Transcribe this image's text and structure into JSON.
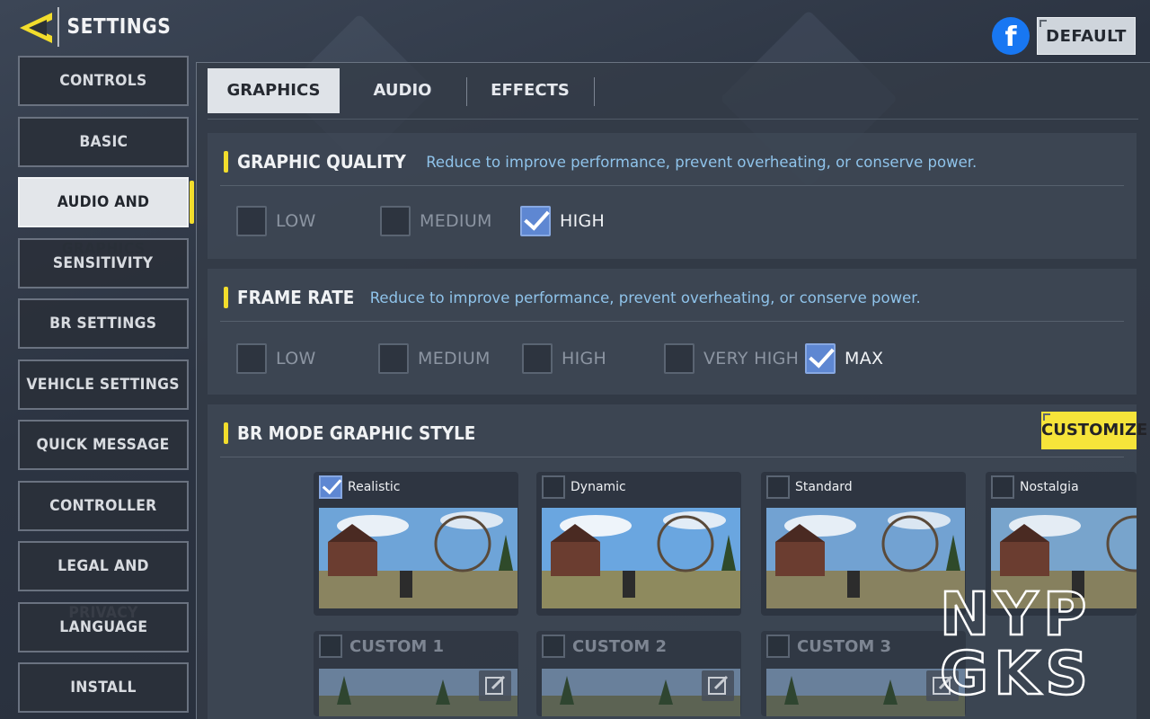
{
  "header": {
    "title": "SETTINGS",
    "default_label": "DEFAULT",
    "facebook_letter": "f"
  },
  "sidebar": {
    "items": [
      {
        "label": "CONTROLS",
        "active": false
      },
      {
        "label": "BASIC",
        "active": false
      },
      {
        "label": "AUDIO AND GRAPHICS",
        "active": true
      },
      {
        "label": "SENSITIVITY",
        "active": false
      },
      {
        "label": "BR SETTINGS",
        "active": false
      },
      {
        "label": "VEHICLE SETTINGS",
        "active": false
      },
      {
        "label": "QUICK MESSAGE",
        "active": false
      },
      {
        "label": "CONTROLLER",
        "active": false
      },
      {
        "label": "LEGAL AND PRIVACY",
        "active": false
      },
      {
        "label": "LANGUAGE",
        "active": false
      },
      {
        "label": "INSTALL",
        "active": false
      }
    ]
  },
  "tabs": [
    {
      "label": "GRAPHICS",
      "active": true
    },
    {
      "label": "AUDIO",
      "active": false
    },
    {
      "label": "EFFECTS",
      "active": false
    }
  ],
  "graphic_quality": {
    "title": "GRAPHIC QUALITY",
    "description": "Reduce to improve performance, prevent overheating, or conserve power.",
    "options": [
      {
        "label": "LOW",
        "checked": false
      },
      {
        "label": "MEDIUM",
        "checked": false
      },
      {
        "label": "HIGH",
        "checked": true
      }
    ]
  },
  "frame_rate": {
    "title": "FRAME RATE",
    "description": "Reduce to improve performance, prevent overheating, or conserve power.",
    "options": [
      {
        "label": "LOW",
        "checked": false
      },
      {
        "label": "MEDIUM",
        "checked": false
      },
      {
        "label": "HIGH",
        "checked": false
      },
      {
        "label": "VERY HIGH",
        "checked": false
      },
      {
        "label": "MAX",
        "checked": true
      }
    ]
  },
  "br_style": {
    "title": "BR MODE GRAPHIC STYLE",
    "customize_label": "CUSTOMIZE",
    "styles": [
      {
        "name": "Realistic",
        "checked": true
      },
      {
        "name": "Dynamic",
        "checked": false
      },
      {
        "name": "Standard",
        "checked": false
      },
      {
        "name": "Nostalgia",
        "checked": false
      }
    ],
    "customs": [
      {
        "name": "CUSTOM 1"
      },
      {
        "name": "CUSTOM 2"
      },
      {
        "name": "CUSTOM 3"
      }
    ]
  },
  "watermark": {
    "line1": "NYP",
    "line2": "GKS"
  },
  "colors": {
    "accent": "#f2dd2c",
    "check": "#5e87d2",
    "desc": "#8fc3ea",
    "facebook": "#1877f2"
  }
}
